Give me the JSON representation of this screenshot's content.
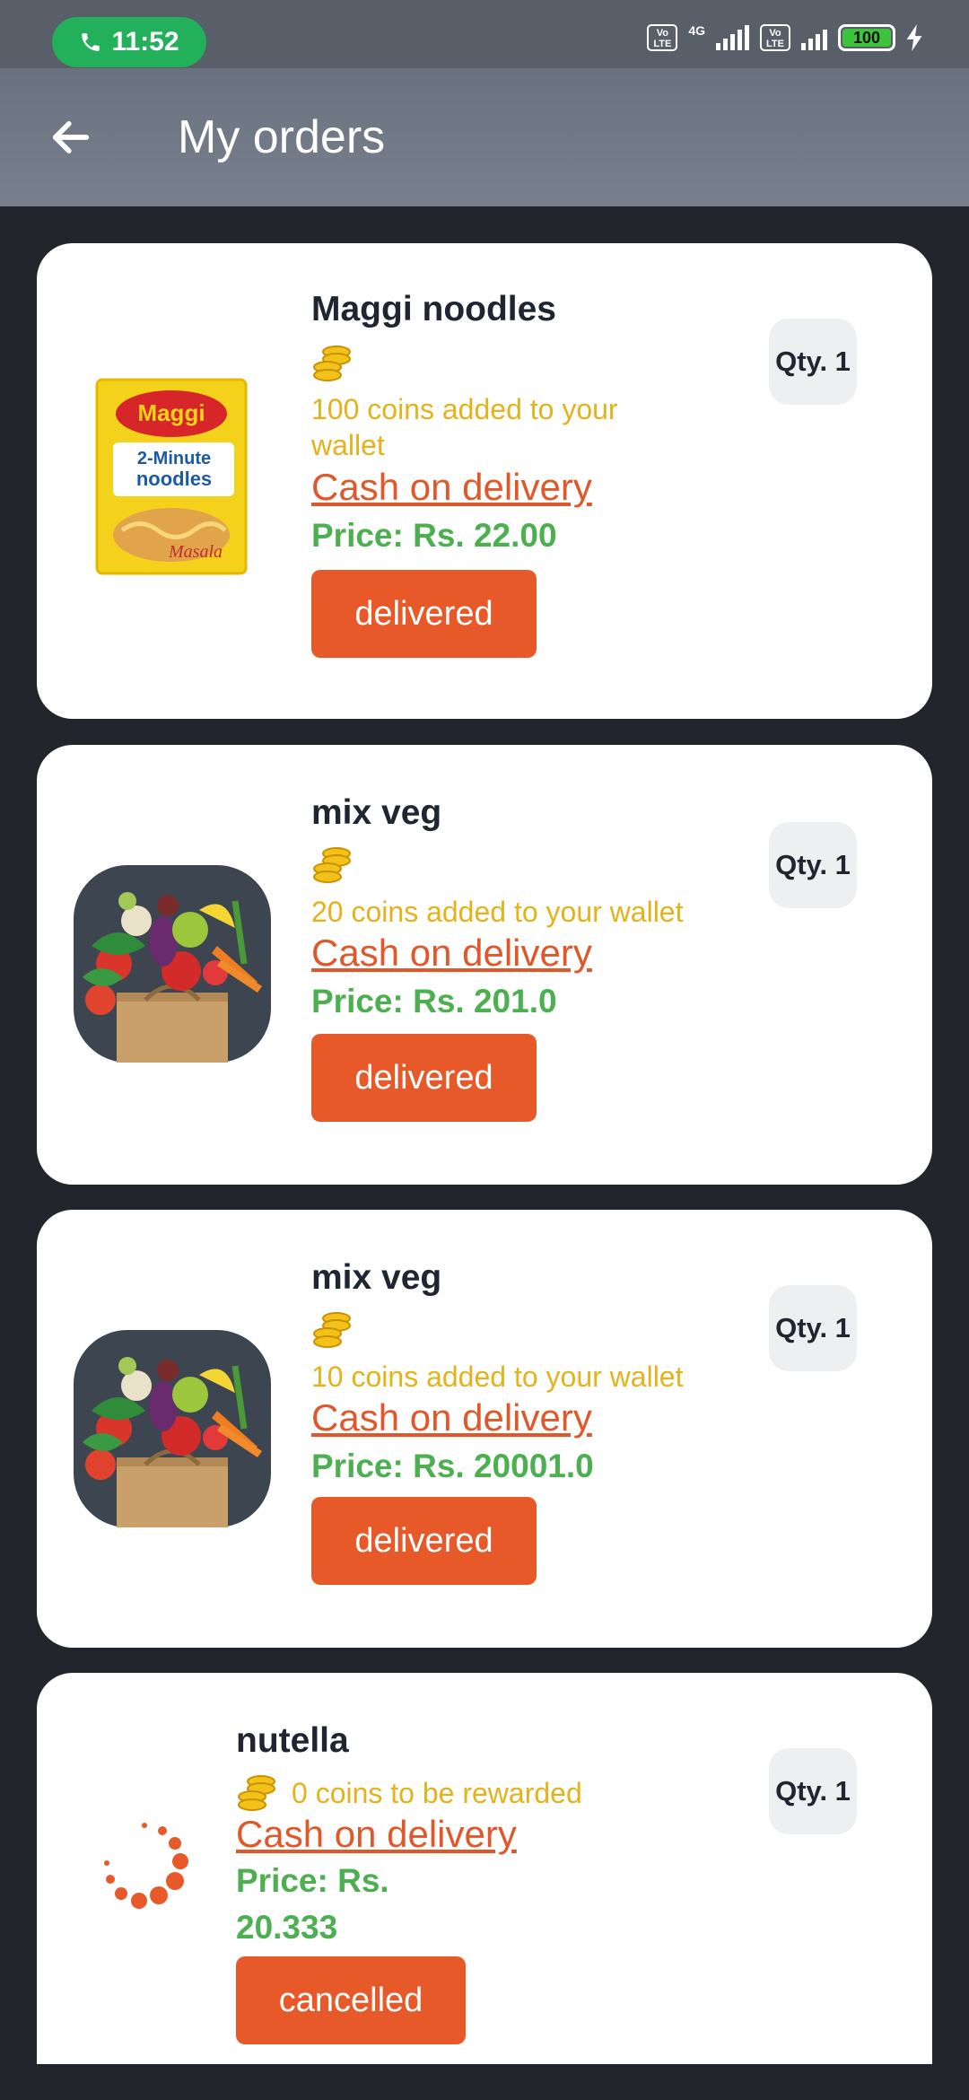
{
  "status_bar": {
    "time": "11:52",
    "network": "4G",
    "volte": "Vo LTE",
    "battery": "100"
  },
  "header": {
    "title": "My orders"
  },
  "orders": [
    {
      "name": "Maggi noodles",
      "coins": "100 coins added to your wallet",
      "payment": "Cash on delivery",
      "price": "Price: Rs. 22.00",
      "status": "delivered",
      "qty": "Qty. 1",
      "image": "maggi-noodles-pack",
      "image_text": [
        "Maggi",
        "2-Minute",
        "noodles",
        "Masala"
      ]
    },
    {
      "name": "mix veg",
      "coins": "20 coins added to your wallet",
      "payment": "Cash on delivery",
      "price": "Price: Rs. 201.0",
      "status": "delivered",
      "qty": "Qty. 1",
      "image": "vegetable-bag"
    },
    {
      "name": "mix veg",
      "coins": "10 coins added to your wallet",
      "payment": "Cash on delivery",
      "price": "Price: Rs. 20001.0",
      "status": "delivered",
      "qty": "Qty. 1",
      "image": "vegetable-bag"
    },
    {
      "name": "nutella",
      "coins": "0 coins to be rewarded",
      "payment": "Cash on delivery",
      "price": "Price: Rs. 20.333",
      "status": "cancelled",
      "qty": "Qty. 1",
      "image": "loading-spinner"
    }
  ],
  "colors": {
    "background": "#22262c",
    "app_bar": "#707985",
    "accent": "#e8592a",
    "coins": "#e4b21a",
    "price": "#4caf50",
    "call_pill": "#22b05a"
  }
}
